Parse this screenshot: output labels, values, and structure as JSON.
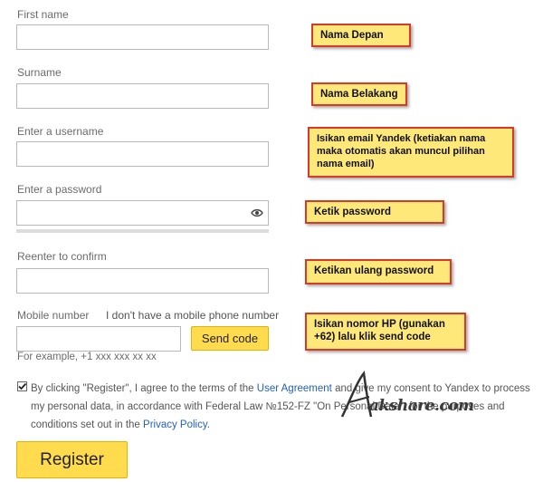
{
  "form": {
    "first_name": {
      "label": "First name",
      "value": ""
    },
    "surname": {
      "label": "Surname",
      "value": ""
    },
    "username": {
      "label": "Enter a username",
      "value": ""
    },
    "password": {
      "label": "Enter a password",
      "value": "",
      "show_icon": "eye-icon"
    },
    "confirm": {
      "label": "Reenter to confirm",
      "value": ""
    },
    "mobile": {
      "label": "Mobile number",
      "no_phone_link": "I don't have a mobile phone number",
      "value": "",
      "example": "For example, +1 xxx xxx xx xx",
      "send_code": "Send code"
    },
    "terms": {
      "checked": true,
      "t1": "By clicking \"Register\", I agree to the terms of the ",
      "user_agreement": "User Agreement",
      "t2": " and give my consent to Yandex to process my personal data, in accordance with Federal Law №152-FZ \"On Personal Data\", for the purposes and conditions set out in the ",
      "privacy_policy": "Privacy Policy",
      "t3": "."
    },
    "register": "Register"
  },
  "annotations": {
    "first": "Nama Depan",
    "surname": "Nama Belakang",
    "username": "Isikan email Yandek (ketiakan nama maka otomatis akan muncul pilihan nama email)",
    "password": "Ketik password",
    "confirm": "Ketikan ulang password",
    "mobile": "Isikan nomor HP (gunakan +62) lalu klik send code"
  },
  "watermark": "akshare.com",
  "colors": {
    "accent_yellow": "#ffdb4d",
    "link": "#2360c0",
    "note_border": "#d83a2a",
    "note_fill": "#ffe87a"
  }
}
